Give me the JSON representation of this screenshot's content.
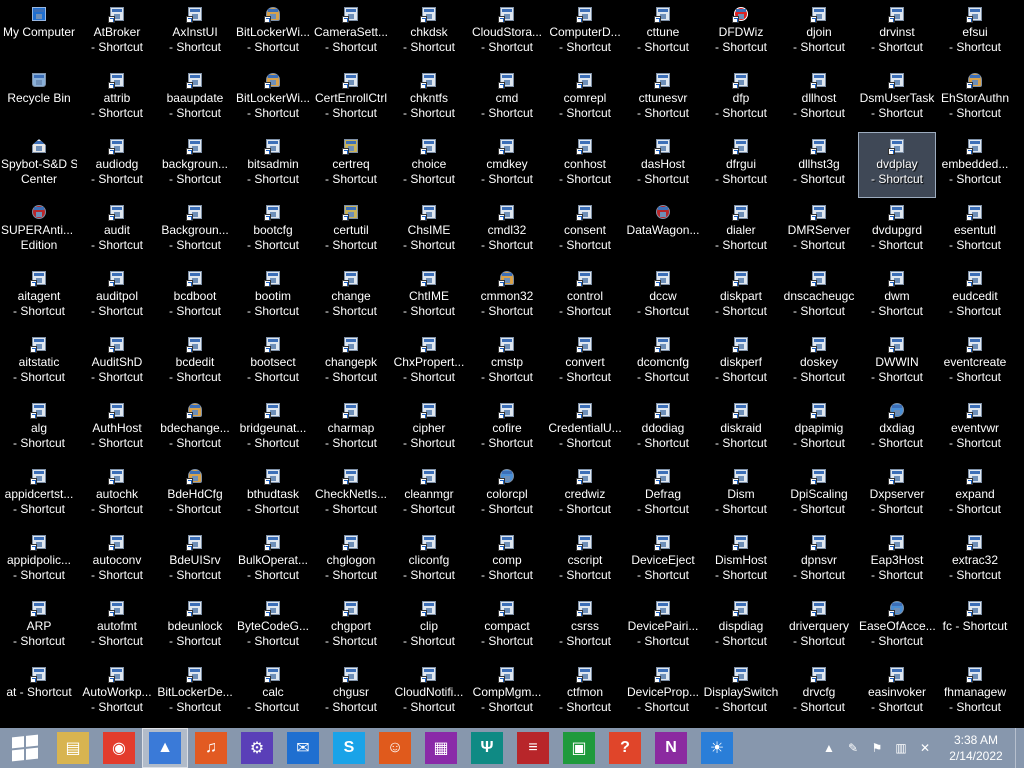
{
  "desktop": {
    "selected_index": 123,
    "icons": [
      {
        "label": "My Computer",
        "kind": "computer"
      },
      {
        "label": "Recycle Bin",
        "kind": "recycle"
      },
      {
        "label": "Spybot-S&D Start Center",
        "kind": "house"
      },
      {
        "label": "SUPERAnti... Free Edition",
        "kind": "red"
      },
      {
        "label": "aitagent - Shortcut",
        "kind": "app"
      },
      {
        "label": "aitstatic - Shortcut",
        "kind": "app"
      },
      {
        "label": "alg - Shortcut",
        "kind": "app"
      },
      {
        "label": "appidcertst... - Shortcut",
        "kind": "app"
      },
      {
        "label": "appidpolic... - Shortcut",
        "kind": "app"
      },
      {
        "label": "ARP - Shortcut",
        "kind": "app"
      },
      {
        "label": "at - Shortcut",
        "kind": "app"
      },
      {
        "label": "AtBroker - Shortcut",
        "kind": "app"
      },
      {
        "label": "attrib - Shortcut",
        "kind": "app"
      },
      {
        "label": "audiodg - Shortcut",
        "kind": "app"
      },
      {
        "label": "audit - Shortcut",
        "kind": "app"
      },
      {
        "label": "auditpol - Shortcut",
        "kind": "app"
      },
      {
        "label": "AuditShD - Shortcut",
        "kind": "app"
      },
      {
        "label": "AuthHost - Shortcut",
        "kind": "app"
      },
      {
        "label": "autochk - Shortcut",
        "kind": "app"
      },
      {
        "label": "autoconv - Shortcut",
        "kind": "app"
      },
      {
        "label": "autofmt - Shortcut",
        "kind": "app"
      },
      {
        "label": "AutoWorkp... - Shortcut",
        "kind": "app"
      },
      {
        "label": "AxInstUI - Shortcut",
        "kind": "app"
      },
      {
        "label": "baaupdate - Shortcut",
        "kind": "app"
      },
      {
        "label": "backgroun... - Shortcut",
        "kind": "app"
      },
      {
        "label": "Backgroun... - Shortcut",
        "kind": "app"
      },
      {
        "label": "bcdboot - Shortcut",
        "kind": "app"
      },
      {
        "label": "bcdedit - Shortcut",
        "kind": "app"
      },
      {
        "label": "bdechange... - Shortcut",
        "kind": "people"
      },
      {
        "label": "BdeHdCfg - Shortcut",
        "kind": "people"
      },
      {
        "label": "BdeUISrv - Shortcut",
        "kind": "app"
      },
      {
        "label": "bdeunlock - Shortcut",
        "kind": "app"
      },
      {
        "label": "BitLockerDe... - Shortcut",
        "kind": "app"
      },
      {
        "label": "BitLockerWi... - Shortcut",
        "kind": "people"
      },
      {
        "label": "BitLockerWi... - Shortcut",
        "kind": "people"
      },
      {
        "label": "bitsadmin - Shortcut",
        "kind": "app"
      },
      {
        "label": "bootcfg - Shortcut",
        "kind": "app"
      },
      {
        "label": "bootim - Shortcut",
        "kind": "app"
      },
      {
        "label": "bootsect - Shortcut",
        "kind": "app"
      },
      {
        "label": "bridgeunat... - Shortcut",
        "kind": "app"
      },
      {
        "label": "bthudtask - Shortcut",
        "kind": "app"
      },
      {
        "label": "BulkOperat... - Shortcut",
        "kind": "app"
      },
      {
        "label": "ByteCodeG... - Shortcut",
        "kind": "app"
      },
      {
        "label": "calc - Shortcut",
        "kind": "app"
      },
      {
        "label": "CameraSett... - Shortcut",
        "kind": "app"
      },
      {
        "label": "CertEnrollCtrl - Shortcut",
        "kind": "app"
      },
      {
        "label": "certreq - Shortcut",
        "kind": "gear"
      },
      {
        "label": "certutil - Shortcut",
        "kind": "gear"
      },
      {
        "label": "change - Shortcut",
        "kind": "app"
      },
      {
        "label": "changepk - Shortcut",
        "kind": "app"
      },
      {
        "label": "charmap - Shortcut",
        "kind": "app"
      },
      {
        "label": "CheckNetIs... - Shortcut",
        "kind": "app"
      },
      {
        "label": "chglogon - Shortcut",
        "kind": "app"
      },
      {
        "label": "chgport - Shortcut",
        "kind": "app"
      },
      {
        "label": "chgusr - Shortcut",
        "kind": "app"
      },
      {
        "label": "chkdsk - Shortcut",
        "kind": "app"
      },
      {
        "label": "chkntfs - Shortcut",
        "kind": "app"
      },
      {
        "label": "choice - Shortcut",
        "kind": "app"
      },
      {
        "label": "ChsIME - Shortcut",
        "kind": "app"
      },
      {
        "label": "ChtIME - Shortcut",
        "kind": "app"
      },
      {
        "label": "ChxPropert... - Shortcut",
        "kind": "app"
      },
      {
        "label": "cipher - Shortcut",
        "kind": "app"
      },
      {
        "label": "cleanmgr - Shortcut",
        "kind": "app"
      },
      {
        "label": "cliconfg - Shortcut",
        "kind": "app"
      },
      {
        "label": "clip - Shortcut",
        "kind": "app"
      },
      {
        "label": "CloudNotifi... - Shortcut",
        "kind": "app"
      },
      {
        "label": "CloudStora... - Shortcut",
        "kind": "app"
      },
      {
        "label": "cmd - Shortcut",
        "kind": "app"
      },
      {
        "label": "cmdkey - Shortcut",
        "kind": "app"
      },
      {
        "label": "cmdl32 - Shortcut",
        "kind": "app"
      },
      {
        "label": "cmmon32 - Shortcut",
        "kind": "people"
      },
      {
        "label": "cmstp - Shortcut",
        "kind": "app"
      },
      {
        "label": "cofire - Shortcut",
        "kind": "app"
      },
      {
        "label": "colorcpl - Shortcut",
        "kind": "globe"
      },
      {
        "label": "comp - Shortcut",
        "kind": "app"
      },
      {
        "label": "compact - Shortcut",
        "kind": "app"
      },
      {
        "label": "CompMgm... - Shortcut",
        "kind": "app"
      },
      {
        "label": "ComputerD... - Shortcut",
        "kind": "app"
      },
      {
        "label": "comrepl - Shortcut",
        "kind": "app"
      },
      {
        "label": "conhost - Shortcut",
        "kind": "app"
      },
      {
        "label": "consent - Shortcut",
        "kind": "app"
      },
      {
        "label": "control - Shortcut",
        "kind": "app"
      },
      {
        "label": "convert - Shortcut",
        "kind": "app"
      },
      {
        "label": "CredentialU... - Shortcut",
        "kind": "app"
      },
      {
        "label": "credwiz - Shortcut",
        "kind": "app"
      },
      {
        "label": "cscript - Shortcut",
        "kind": "app"
      },
      {
        "label": "csrss - Shortcut",
        "kind": "app"
      },
      {
        "label": "ctfmon - Shortcut",
        "kind": "app"
      },
      {
        "label": "cttune - Shortcut",
        "kind": "app"
      },
      {
        "label": "cttunesvr - Shortcut",
        "kind": "app"
      },
      {
        "label": "dasHost - Shortcut",
        "kind": "app"
      },
      {
        "label": "DataWagon...",
        "kind": "red"
      },
      {
        "label": "dccw - Shortcut",
        "kind": "app"
      },
      {
        "label": "dcomcnfg - Shortcut",
        "kind": "app"
      },
      {
        "label": "ddodiag - Shortcut",
        "kind": "app"
      },
      {
        "label": "Defrag - Shortcut",
        "kind": "app"
      },
      {
        "label": "DeviceEject - Shortcut",
        "kind": "app"
      },
      {
        "label": "DevicePairi... - Shortcut",
        "kind": "app"
      },
      {
        "label": "DeviceProp... - Shortcut",
        "kind": "app"
      },
      {
        "label": "DFDWiz - Shortcut",
        "kind": "warn"
      },
      {
        "label": "dfp - Shortcut",
        "kind": "app"
      },
      {
        "label": "dfrgui - Shortcut",
        "kind": "app"
      },
      {
        "label": "dialer - Shortcut",
        "kind": "app"
      },
      {
        "label": "diskpart - Shortcut",
        "kind": "app"
      },
      {
        "label": "diskperf - Shortcut",
        "kind": "app"
      },
      {
        "label": "diskraid - Shortcut",
        "kind": "app"
      },
      {
        "label": "Dism - Shortcut",
        "kind": "app"
      },
      {
        "label": "DismHost - Shortcut",
        "kind": "app"
      },
      {
        "label": "dispdiag - Shortcut",
        "kind": "app"
      },
      {
        "label": "DisplaySwitch - Shortcut",
        "kind": "app"
      },
      {
        "label": "djoin - Shortcut",
        "kind": "app"
      },
      {
        "label": "dllhost - Shortcut",
        "kind": "app"
      },
      {
        "label": "dllhst3g - Shortcut",
        "kind": "app"
      },
      {
        "label": "DMRServer - Shortcut",
        "kind": "app"
      },
      {
        "label": "dnscacheugc - Shortcut",
        "kind": "app"
      },
      {
        "label": "doskey - Shortcut",
        "kind": "app"
      },
      {
        "label": "dpapimig - Shortcut",
        "kind": "app"
      },
      {
        "label": "DpiScaling - Shortcut",
        "kind": "app"
      },
      {
        "label": "dpnsvr - Shortcut",
        "kind": "app"
      },
      {
        "label": "driverquery - Shortcut",
        "kind": "app"
      },
      {
        "label": "drvcfg - Shortcut",
        "kind": "app"
      },
      {
        "label": "drvinst - Shortcut",
        "kind": "app"
      },
      {
        "label": "DsmUserTask - Shortcut",
        "kind": "app"
      },
      {
        "label": "dvdplay - Shortcut",
        "kind": "app"
      },
      {
        "label": "dvdupgrd - Shortcut",
        "kind": "app"
      },
      {
        "label": "dwm - Shortcut",
        "kind": "app"
      },
      {
        "label": "DWWIN - Shortcut",
        "kind": "app"
      },
      {
        "label": "dxdiag - Shortcut",
        "kind": "globe"
      },
      {
        "label": "Dxpserver - Shortcut",
        "kind": "app"
      },
      {
        "label": "Eap3Host - Shortcut",
        "kind": "app"
      },
      {
        "label": "EaseOfAcce... - Shortcut",
        "kind": "globe"
      },
      {
        "label": "easinvoker - Shortcut",
        "kind": "app"
      },
      {
        "label": "efsui - Shortcut",
        "kind": "app"
      },
      {
        "label": "EhStorAuthn - Shortcut",
        "kind": "people"
      },
      {
        "label": "embedded... - Shortcut",
        "kind": "app"
      },
      {
        "label": "esentutl - Shortcut",
        "kind": "app"
      },
      {
        "label": "eudcedit - Shortcut",
        "kind": "app"
      },
      {
        "label": "eventcreate - Shortcut",
        "kind": "app"
      },
      {
        "label": "eventvwr - Shortcut",
        "kind": "app"
      },
      {
        "label": "expand - Shortcut",
        "kind": "app"
      },
      {
        "label": "extrac32 - Shortcut",
        "kind": "app"
      },
      {
        "label": "fc - Shortcut",
        "kind": "app"
      },
      {
        "label": "fhmanagew - Shortcut",
        "kind": "app"
      }
    ]
  },
  "taskbar": {
    "items": [
      {
        "name": "file-explorer-button",
        "glyph": "▤",
        "bg": "#d8b450",
        "active": false
      },
      {
        "name": "chrome-button",
        "glyph": "◉",
        "bg": "#e33c2c",
        "active": false
      },
      {
        "name": "pinned-app-button",
        "glyph": "▲",
        "bg": "#3a7ad8",
        "active": true
      },
      {
        "name": "music-app-button",
        "glyph": "♫",
        "bg": "#e25a22",
        "active": false
      },
      {
        "name": "settings-app-button",
        "glyph": "⚙",
        "bg": "#5a3fb8",
        "active": false
      },
      {
        "name": "mail-app-button",
        "glyph": "✉",
        "bg": "#1f6fd0",
        "active": false
      },
      {
        "name": "skype-app-button",
        "glyph": "S",
        "bg": "#1aa3e8",
        "active": false
      },
      {
        "name": "people-app-button",
        "glyph": "☺",
        "bg": "#e05a1c",
        "active": false
      },
      {
        "name": "maps-app-button",
        "glyph": "▦",
        "bg": "#8a2aa8",
        "active": false
      },
      {
        "name": "food-app-button",
        "glyph": "Ψ",
        "bg": "#0f8a84",
        "active": false
      },
      {
        "name": "news-app-button",
        "glyph": "≡",
        "bg": "#b8262a",
        "active": false
      },
      {
        "name": "store-app-button",
        "glyph": "▣",
        "bg": "#1f9a3c",
        "active": false
      },
      {
        "name": "help-app-button",
        "glyph": "?",
        "bg": "#e0452a",
        "active": false
      },
      {
        "name": "onenote-app-button",
        "glyph": "N",
        "bg": "#8b2aa0",
        "active": false
      },
      {
        "name": "weather-app-button",
        "glyph": "☀",
        "bg": "#2a7ed8",
        "active": false
      }
    ],
    "tray": [
      {
        "name": "tray-overflow-icon",
        "glyph": "▲"
      },
      {
        "name": "acrobat-tray-icon",
        "glyph": "✎"
      },
      {
        "name": "action-center-flag-icon",
        "glyph": "⚑"
      },
      {
        "name": "network-tray-icon",
        "glyph": "▥"
      },
      {
        "name": "volume-muted-icon",
        "glyph": "✕"
      }
    ],
    "clock": {
      "time": "3:38 AM",
      "date": "2/14/2022"
    }
  }
}
